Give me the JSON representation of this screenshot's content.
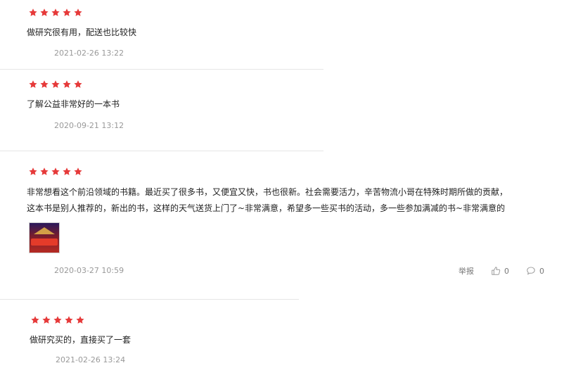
{
  "star_color": "#e63a3a",
  "reviews": [
    {
      "rating": 5,
      "text": "做研究很有用，配送也比较快",
      "date": "2021-02-26 13:22"
    },
    {
      "rating": 5,
      "text": "了解公益非常好的一本书",
      "date": "2020-09-21 13:12"
    },
    {
      "rating": 5,
      "text_line1": "非常想看这个前沿领域的书籍。最近买了很多书，又便宜又快，书也很新。社会需要活力，辛苦物流小哥在特殊时期所做的贡献，",
      "text_line2": "这本书是别人推荐的，新出的书，这样的天气送货上门了~非常满意，希望多一些买书的活动，多一些参加满减的书~非常满意的",
      "date": "2020-03-27 10:59",
      "has_image": true,
      "actions": {
        "report_label": "举报",
        "like_count": "0",
        "comment_count": "0"
      }
    },
    {
      "rating": 5,
      "text": "做研究买的，直接买了一套",
      "date": "2021-02-26 13:24"
    }
  ]
}
